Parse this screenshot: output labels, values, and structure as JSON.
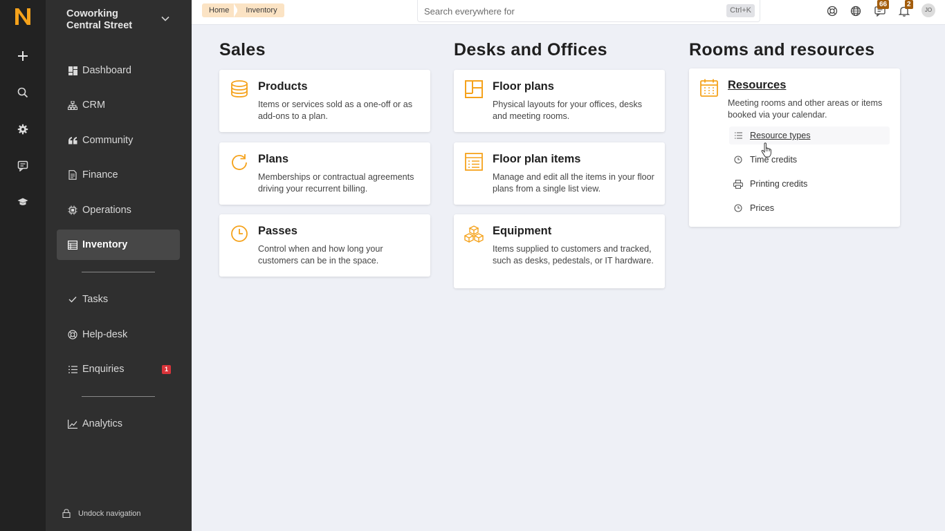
{
  "brand": {
    "logo_letter": "N",
    "accent_color": "#f5a21b"
  },
  "rail": {
    "icons": [
      "plus-icon",
      "search-icon",
      "gear-icon",
      "chat-icon",
      "graduation-cap-icon"
    ]
  },
  "sidebar": {
    "workspace_line1": "Coworking",
    "workspace_line2": "Central Street",
    "items": [
      {
        "label": "Dashboard",
        "icon": "dashboard-icon"
      },
      {
        "label": "CRM",
        "icon": "sitemap-icon"
      },
      {
        "label": "Community",
        "icon": "quote-icon"
      },
      {
        "label": "Finance",
        "icon": "document-icon"
      },
      {
        "label": "Operations",
        "icon": "chip-icon"
      },
      {
        "label": "Inventory",
        "icon": "table-icon",
        "active": true
      },
      {
        "label": "Tasks",
        "icon": "check-icon"
      },
      {
        "label": "Help-desk",
        "icon": "lifebuoy-icon"
      },
      {
        "label": "Enquiries",
        "icon": "list-icon",
        "badge": "1"
      },
      {
        "label": "Analytics",
        "icon": "chart-icon"
      }
    ],
    "undock_label": "Undock navigation"
  },
  "topbar": {
    "breadcrumbs": [
      "Home",
      "Inventory"
    ],
    "search_placeholder": "Search everywhere for",
    "search_shortcut": "Ctrl+K",
    "messages_badge": "66",
    "notifications_badge": "2",
    "avatar_initials": "JO"
  },
  "columns": [
    {
      "title": "Sales",
      "cards": [
        {
          "title": "Products",
          "desc": "Items or services sold as a one-off or as add-ons to a plan.",
          "icon": "database-icon"
        },
        {
          "title": "Plans",
          "desc": "Memberships or contractual agreements driving your recurrent billing.",
          "icon": "refresh-icon"
        },
        {
          "title": "Passes",
          "desc": "Control when and how long your customers can be in the space.",
          "icon": "clock-icon"
        }
      ]
    },
    {
      "title": "Desks and Offices",
      "cards": [
        {
          "title": "Floor plans",
          "desc": "Physical layouts for your offices, desks and meeting rooms.",
          "icon": "floor-plan-icon"
        },
        {
          "title": "Floor plan items",
          "desc": "Manage and edit all the items in your floor plans from a single list view.",
          "icon": "list-table-icon"
        },
        {
          "title": "Equipment",
          "desc": "Items supplied to customers and tracked, such as desks, pedestals, or IT hardware.",
          "icon": "boxes-icon"
        }
      ]
    },
    {
      "title": "Rooms and resources",
      "cards": [
        {
          "title": "Resources",
          "desc": "Meeting rooms and other areas or items booked via your calendar.",
          "icon": "calendar-icon",
          "links": [
            {
              "label": "Resource types",
              "icon": "list-icon"
            },
            {
              "label": "Time credits",
              "icon": "clock-icon"
            },
            {
              "label": "Printing credits",
              "icon": "printer-icon"
            },
            {
              "label": "Prices",
              "icon": "clock-icon"
            }
          ]
        }
      ]
    }
  ]
}
